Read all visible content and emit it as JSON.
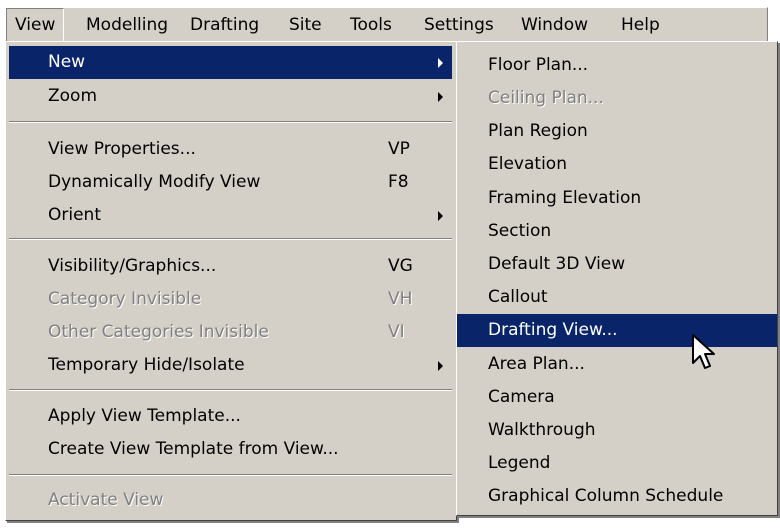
{
  "menubar": {
    "items": [
      {
        "label": "View",
        "open": true
      },
      {
        "label": "Modelling"
      },
      {
        "label": "Drafting"
      },
      {
        "label": "Site"
      },
      {
        "label": "Tools"
      },
      {
        "label": "Settings"
      },
      {
        "label": "Window"
      },
      {
        "label": "Help"
      }
    ]
  },
  "view_menu": {
    "items": [
      {
        "label": "New",
        "has_submenu": true,
        "highlighted": true
      },
      {
        "label": "Zoom",
        "has_submenu": true
      },
      {
        "label": "View Properties...",
        "shortcut": "VP"
      },
      {
        "label": "Dynamically Modify View",
        "shortcut": "F8"
      },
      {
        "label": "Orient",
        "has_submenu": true
      },
      {
        "label": "Visibility/Graphics...",
        "shortcut": "VG"
      },
      {
        "label": "Category Invisible",
        "shortcut": "VH",
        "disabled": true
      },
      {
        "label": "Other Categories Invisible",
        "shortcut": "VI",
        "disabled": true
      },
      {
        "label": "Temporary Hide/Isolate",
        "has_submenu": true
      },
      {
        "label": "Apply View Template..."
      },
      {
        "label": "Create View Template from View..."
      },
      {
        "label": "Activate View",
        "disabled": true
      }
    ]
  },
  "new_submenu": {
    "items": [
      {
        "label": "Floor Plan..."
      },
      {
        "label": "Ceiling Plan...",
        "disabled": true
      },
      {
        "label": "Plan Region"
      },
      {
        "label": "Elevation"
      },
      {
        "label": "Framing Elevation"
      },
      {
        "label": "Section"
      },
      {
        "label": "Default 3D View"
      },
      {
        "label": "Callout"
      },
      {
        "label": "Drafting View...",
        "highlighted": true
      },
      {
        "label": "Area Plan..."
      },
      {
        "label": "Camera"
      },
      {
        "label": "Walkthrough"
      },
      {
        "label": "Legend"
      },
      {
        "label": "Graphical Column Schedule"
      }
    ]
  },
  "colors": {
    "menu_face": "#d4d0c8",
    "highlight": "#0a246a",
    "disabled_text": "#808080"
  }
}
